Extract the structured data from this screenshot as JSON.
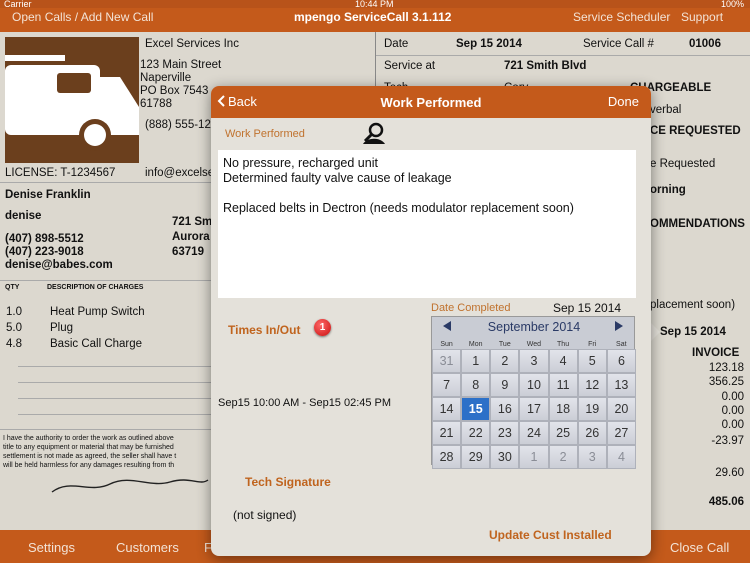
{
  "status": {
    "carrier": "Carrier",
    "time": "10:44 PM",
    "battery": "100%"
  },
  "nav": {
    "left": "Open Calls / Add New Call",
    "title": "mpengo ServiceCall 3.1.112",
    "scheduler": "Service Scheduler",
    "support": "Support"
  },
  "company": {
    "name": "Excel Services Inc",
    "street": "123 Main Street",
    "city": "Naperville",
    "pobox": "PO Box 7543",
    "zip": "61788",
    "phone": "(888) 555-12",
    "license": "LICENSE: T-1234567",
    "email": "info@excelse"
  },
  "customer": {
    "name": "Denise Franklin",
    "first": "denise",
    "phone1": "(407) 898-5512",
    "phone2": "(407) 223-9018",
    "email": "denise@babes.com",
    "addr1": "721 Sm",
    "addr2": "Aurora",
    "addr3": "63719"
  },
  "charges": {
    "qty_header": "QTY",
    "desc_header": "DESCRIPTION OF CHARGES",
    "rows": [
      {
        "qty": "1.0",
        "desc": "Heat Pump Switch"
      },
      {
        "qty": "5.0",
        "desc": "Plug"
      },
      {
        "qty": "4.8",
        "desc": "Basic Call Charge"
      }
    ]
  },
  "terms": [
    "I have the authority to order the work as outlined above",
    "title to any equipment or material that may be furnished",
    "settlement is not made as agreed, the seller shall have t",
    "will be held harmless for any damages resulting from th"
  ],
  "header_right": {
    "date_label": "Date",
    "date": "Sep 15 2014",
    "call_label": "Service Call #",
    "call_no": "01006",
    "service_at_label": "Service at",
    "service_at": "721 Smith Blvd",
    "tech_label": "Tech",
    "tech": "Cory",
    "chargeable": "CHARGEABLE",
    "verbal": "verbal",
    "service_requested": "CE REQUESTED",
    "requested": "e Requested",
    "morning": "orning",
    "recommendations": "OMMENDATIONS",
    "placement": "placement soon)",
    "date2": "Sep 15 2014",
    "invoice": "INVOICE",
    "amounts": [
      "123.18",
      "356.25",
      "0.00",
      "0.00",
      "0.00",
      "-23.97"
    ],
    "subtotal": "29.60",
    "total": "485.06"
  },
  "toolbar": {
    "settings": "Settings",
    "customers": "Customers",
    "f": "F",
    "close_call": "Close Call"
  },
  "modal": {
    "back": "Back",
    "title": "Work Performed",
    "done": "Done",
    "wp_label": "Work Performed",
    "wp_lines": [
      "No pressure, recharged unit",
      "Determined faulty valve cause of leakage",
      "",
      "Replaced belts in Dectron (needs modulator replacement soon)"
    ],
    "times_label": "Times In/Out",
    "times_badge": "1",
    "times_value": "Sep15 10:00 AM - Sep15 02:45 PM",
    "date_completed_label": "Date Completed",
    "date_completed": "Sep 15 2014",
    "tech_sig_label": "Tech Signature",
    "tech_sig_value": "(not signed)",
    "update_label": "Update Cust Installed",
    "calendar": {
      "month": "September 2014",
      "dows": [
        "Sun",
        "Mon",
        "Tue",
        "Wed",
        "Thu",
        "Fri",
        "Sat"
      ],
      "days": [
        {
          "d": "31",
          "o": true
        },
        {
          "d": "1"
        },
        {
          "d": "2"
        },
        {
          "d": "3"
        },
        {
          "d": "4"
        },
        {
          "d": "5"
        },
        {
          "d": "6"
        },
        {
          "d": "7"
        },
        {
          "d": "8"
        },
        {
          "d": "9"
        },
        {
          "d": "10"
        },
        {
          "d": "11"
        },
        {
          "d": "12"
        },
        {
          "d": "13"
        },
        {
          "d": "14"
        },
        {
          "d": "15",
          "s": true
        },
        {
          "d": "16"
        },
        {
          "d": "17"
        },
        {
          "d": "18"
        },
        {
          "d": "19"
        },
        {
          "d": "20"
        },
        {
          "d": "21"
        },
        {
          "d": "22"
        },
        {
          "d": "23"
        },
        {
          "d": "24"
        },
        {
          "d": "25"
        },
        {
          "d": "26"
        },
        {
          "d": "27"
        },
        {
          "d": "28"
        },
        {
          "d": "29"
        },
        {
          "d": "30"
        },
        {
          "d": "1",
          "o": true
        },
        {
          "d": "2",
          "o": true
        },
        {
          "d": "3",
          "o": true
        },
        {
          "d": "4",
          "o": true
        }
      ]
    }
  }
}
